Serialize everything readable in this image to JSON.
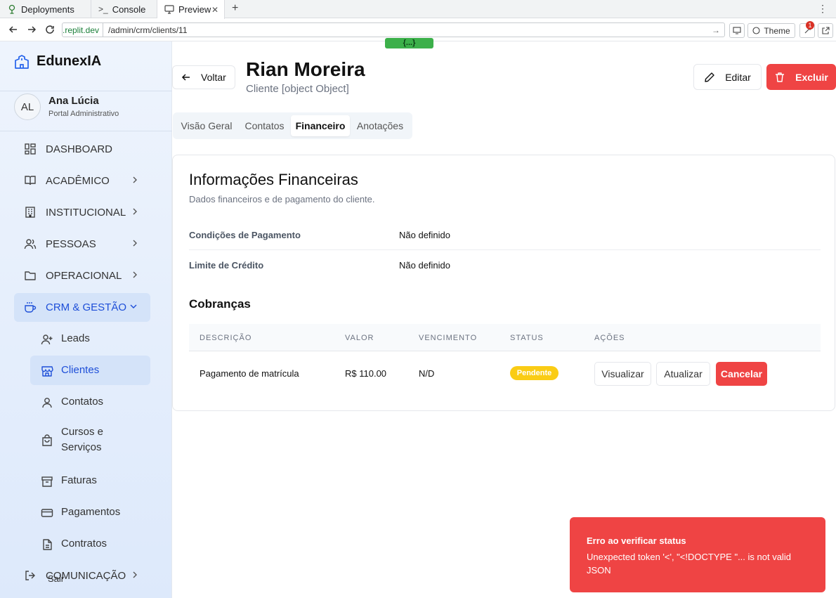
{
  "browser": {
    "tabs": [
      {
        "label": "Deployments",
        "icon": "deployments-icon"
      },
      {
        "label": "Console",
        "icon": "console-icon"
      },
      {
        "label": "Preview",
        "icon": "preview-icon",
        "active": true
      }
    ],
    "url_domain_badge": "{...}",
    "url_domain": ".replit.dev",
    "url_path": "/admin/crm/clients/11",
    "theme_label": "Theme",
    "notification_count": "1"
  },
  "sidebar": {
    "brand": "EdunexIA",
    "user": {
      "initials": "AL",
      "name": "Ana Lúcia",
      "role": "Portal Administrativo"
    },
    "items": [
      {
        "label": "DASHBOARD",
        "icon": "dashboard-grid-icon"
      },
      {
        "label": "ACADÊMICO",
        "icon": "book-open-icon"
      },
      {
        "label": "INSTITUCIONAL",
        "icon": "building-icon"
      },
      {
        "label": "PESSOAS",
        "icon": "users-icon"
      },
      {
        "label": "OPERACIONAL",
        "icon": "folder-icon"
      },
      {
        "label": "CRM & GESTÃO",
        "icon": "coffee-icon",
        "open": true
      },
      {
        "label": "COMUNICAÇÃO",
        "icon": "logout-icon"
      }
    ],
    "subitems": [
      {
        "label": "Leads",
        "icon": "user-plus-icon"
      },
      {
        "label": "Clientes",
        "icon": "store-icon",
        "active": true
      },
      {
        "label": "Contatos",
        "icon": "user-icon"
      },
      {
        "label": "Cursos e Serviços",
        "line1": "Cursos e",
        "line2": "Serviços",
        "icon": "shopping-bag-icon"
      },
      {
        "label": "Faturas",
        "icon": "archive-icon"
      },
      {
        "label": "Pagamentos",
        "icon": "credit-card-icon"
      },
      {
        "label": "Contratos",
        "icon": "file-text-icon"
      }
    ],
    "logout_label": "Sair"
  },
  "header": {
    "back_label": "Voltar",
    "title": "Rian Moreira",
    "subtitle": "Cliente [object Object]",
    "edit_label": "Editar",
    "delete_label": "Excluir"
  },
  "tabs": [
    {
      "label": "Visão Geral"
    },
    {
      "label": "Contatos"
    },
    {
      "label": "Financeiro",
      "active": true
    },
    {
      "label": "Anotações"
    }
  ],
  "finance": {
    "title": "Informações Financeiras",
    "description": "Dados financeiros e de pagamento do cliente.",
    "fields": [
      {
        "label": "Condições de Pagamento",
        "value": "Não definido"
      },
      {
        "label": "Limite de Crédito",
        "value": "Não definido"
      }
    ],
    "charges_title": "Cobranças",
    "columns": [
      "DESCRIÇÃO",
      "VALOR",
      "VENCIMENTO",
      "STATUS",
      "AÇÕES"
    ],
    "rows": [
      {
        "description": "Pagamento de matrícula",
        "value": "R$ 110.00",
        "due": "N/D",
        "status": "Pendente",
        "status_color": "#facc15",
        "actions": [
          "Visualizar",
          "Atualizar",
          "Cancelar"
        ]
      }
    ]
  },
  "toast": {
    "title": "Erro ao verificar status",
    "message": "Unexpected token '<', \"<!DOCTYPE \"... is not valid JSON",
    "color": "#ef4444"
  }
}
